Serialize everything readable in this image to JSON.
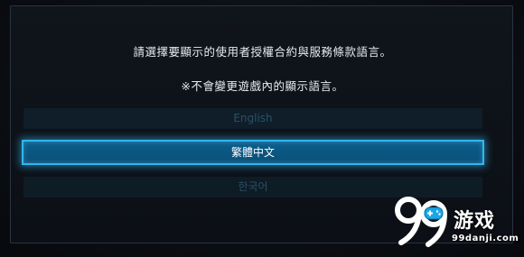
{
  "dialog": {
    "prompt_line1": "請選擇要顯示的使用者授權合約與服務條款語言。",
    "prompt_line2": "※不會變更遊戲內的顯示語言。"
  },
  "languages": [
    {
      "label": "English",
      "state": "dimmed"
    },
    {
      "label": "繁體中文",
      "state": "selected"
    },
    {
      "label": "한국어",
      "state": "dimmed"
    }
  ],
  "colors": {
    "selected_border": "#2fb6f0",
    "selected_fill": "#0a5886",
    "dimmed_fill": "#0f1e29",
    "dimmed_text": "#2b5166"
  },
  "watermark": {
    "name": "游戏",
    "domain": "99danji.com",
    "logo_icon": "99-gamepad-logo-icon"
  }
}
